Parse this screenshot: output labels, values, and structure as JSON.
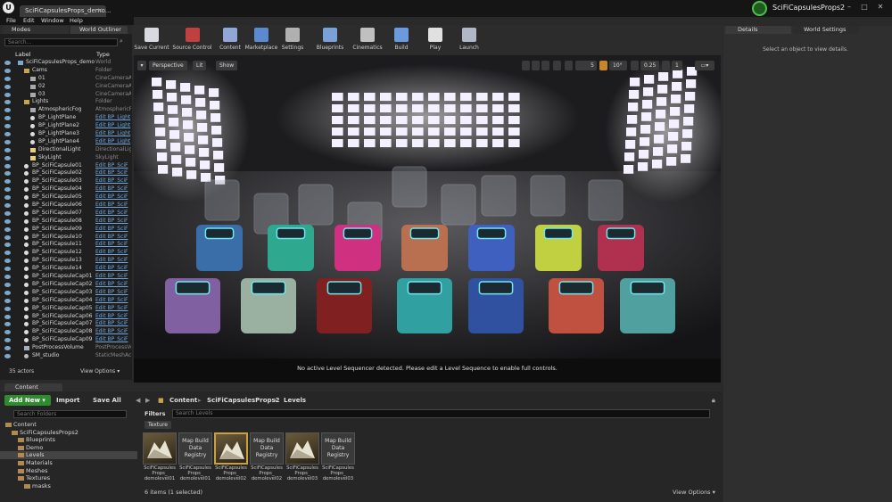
{
  "app": {
    "document_tab": "SciFiCapsulesProps_demo...",
    "project_name": "SciFiCapsulesProps2",
    "logo": "unreal-logo",
    "window_buttons": [
      "–",
      "□",
      "✕"
    ]
  },
  "menu": [
    "File",
    "Edit",
    "Window",
    "Help"
  ],
  "panels": {
    "modes_tab": "Modes",
    "outliner_tab": "World Outliner",
    "details_tab": "Details",
    "world_settings_tab": "World Settings",
    "content_browser_tab": "Content Browser"
  },
  "outliner": {
    "search_placeholder": "Search...",
    "col_label": "Label",
    "col_type": "Type",
    "rows": [
      {
        "label": "SciFiCapsulesProps_demo",
        "type": "World",
        "indent": 0,
        "icon": "world"
      },
      {
        "label": "Cams",
        "type": "Folder",
        "indent": 1,
        "icon": "folder"
      },
      {
        "label": "01",
        "type": "CineCameraA",
        "indent": 2,
        "icon": "camera"
      },
      {
        "label": "02",
        "type": "CineCameraA",
        "indent": 2,
        "icon": "camera"
      },
      {
        "label": "03",
        "type": "CineCameraA",
        "indent": 2,
        "icon": "camera"
      },
      {
        "label": "Lights",
        "type": "Folder",
        "indent": 1,
        "icon": "folder"
      },
      {
        "label": "AtmosphericFog",
        "type": "AtmosphericF",
        "indent": 2,
        "icon": "fog"
      },
      {
        "label": "BP_LightPlane",
        "type": "Edit BP_Light",
        "indent": 2,
        "icon": "bp",
        "link": true
      },
      {
        "label": "BP_LightPlane2",
        "type": "Edit BP_Light",
        "indent": 2,
        "icon": "bp",
        "link": true
      },
      {
        "label": "BP_LightPlane3",
        "type": "Edit BP_Light",
        "indent": 2,
        "icon": "bp",
        "link": true
      },
      {
        "label": "BP_LightPlane4",
        "type": "Edit BP_Light",
        "indent": 2,
        "icon": "bp",
        "link": true
      },
      {
        "label": "DirectionalLight",
        "type": "DirectionalLigh",
        "indent": 2,
        "icon": "light"
      },
      {
        "label": "SkyLight",
        "type": "SkyLight",
        "indent": 2,
        "icon": "light"
      },
      {
        "label": "BP_SciFiCapsule01",
        "type": "Edit BP_SciF",
        "indent": 1,
        "icon": "bp",
        "link": true
      },
      {
        "label": "BP_SciFiCapsule02",
        "type": "Edit BP_SciF",
        "indent": 1,
        "icon": "bp",
        "link": true
      },
      {
        "label": "BP_SciFiCapsule03",
        "type": "Edit BP_SciF",
        "indent": 1,
        "icon": "bp",
        "link": true
      },
      {
        "label": "BP_SciFiCapsule04",
        "type": "Edit BP_SciF",
        "indent": 1,
        "icon": "bp",
        "link": true
      },
      {
        "label": "BP_SciFiCapsule05",
        "type": "Edit BP_SciF",
        "indent": 1,
        "icon": "bp",
        "link": true
      },
      {
        "label": "BP_SciFiCapsule06",
        "type": "Edit BP_SciF",
        "indent": 1,
        "icon": "bp",
        "link": true
      },
      {
        "label": "BP_SciFiCapsule07",
        "type": "Edit BP_SciF",
        "indent": 1,
        "icon": "bp",
        "link": true
      },
      {
        "label": "BP_SciFiCapsule08",
        "type": "Edit BP_SciF",
        "indent": 1,
        "icon": "bp",
        "link": true
      },
      {
        "label": "BP_SciFiCapsule09",
        "type": "Edit BP_SciF",
        "indent": 1,
        "icon": "bp",
        "link": true
      },
      {
        "label": "BP_SciFiCapsule10",
        "type": "Edit BP_SciF",
        "indent": 1,
        "icon": "bp",
        "link": true
      },
      {
        "label": "BP_SciFiCapsule11",
        "type": "Edit BP_SciF",
        "indent": 1,
        "icon": "bp",
        "link": true
      },
      {
        "label": "BP_SciFiCapsule12",
        "type": "Edit BP_SciF",
        "indent": 1,
        "icon": "bp",
        "link": true
      },
      {
        "label": "BP_SciFiCapsule13",
        "type": "Edit BP_SciF",
        "indent": 1,
        "icon": "bp",
        "link": true
      },
      {
        "label": "BP_SciFiCapsule14",
        "type": "Edit BP_SciF",
        "indent": 1,
        "icon": "bp",
        "link": true
      },
      {
        "label": "BP_SciFiCapsuleCap01",
        "type": "Edit BP_SciF",
        "indent": 1,
        "icon": "bp",
        "link": true
      },
      {
        "label": "BP_SciFiCapsuleCap02",
        "type": "Edit BP_SciF",
        "indent": 1,
        "icon": "bp",
        "link": true
      },
      {
        "label": "BP_SciFiCapsuleCap03",
        "type": "Edit BP_SciF",
        "indent": 1,
        "icon": "bp",
        "link": true
      },
      {
        "label": "BP_SciFiCapsuleCap04",
        "type": "Edit BP_SciF",
        "indent": 1,
        "icon": "bp",
        "link": true
      },
      {
        "label": "BP_SciFiCapsuleCap05",
        "type": "Edit BP_SciF",
        "indent": 1,
        "icon": "bp",
        "link": true
      },
      {
        "label": "BP_SciFiCapsuleCap06",
        "type": "Edit BP_SciF",
        "indent": 1,
        "icon": "bp",
        "link": true
      },
      {
        "label": "BP_SciFiCapsuleCap07",
        "type": "Edit BP_SciF",
        "indent": 1,
        "icon": "bp",
        "link": true
      },
      {
        "label": "BP_SciFiCapsuleCap08",
        "type": "Edit BP_SciF",
        "indent": 1,
        "icon": "bp",
        "link": true
      },
      {
        "label": "BP_SciFiCapsuleCap09",
        "type": "Edit BP_SciF",
        "indent": 1,
        "icon": "bp",
        "link": true
      },
      {
        "label": "PostProcessVolume",
        "type": "PostProcessVo",
        "indent": 1,
        "icon": "volume"
      },
      {
        "label": "SM_studio",
        "type": "StaticMeshAc",
        "indent": 1,
        "icon": "mesh"
      }
    ],
    "actors_count": "35 actors",
    "view_options": "View Options ▾"
  },
  "toolbar": [
    {
      "label": "Save Current",
      "icon": "save-icon",
      "color": "#d8d8e0"
    },
    {
      "label": "Source Control",
      "icon": "source-control-icon",
      "color": "#c04040"
    },
    {
      "label": "Content",
      "icon": "content-icon",
      "color": "#8fa8d8"
    },
    {
      "label": "Marketplace",
      "icon": "marketplace-icon",
      "color": "#5a8ad0"
    },
    {
      "label": "Settings",
      "icon": "settings-icon",
      "color": "#b0b0b0"
    },
    {
      "label": "Blueprints",
      "icon": "blueprints-icon",
      "color": "#7aa0d8"
    },
    {
      "label": "Cinematics",
      "icon": "cinematics-icon",
      "color": "#c0c0c0"
    },
    {
      "label": "Build",
      "icon": "build-icon",
      "color": "#6a9ae0"
    },
    {
      "label": "Play",
      "icon": "play-icon",
      "color": "#e0e0e0"
    },
    {
      "label": "Launch",
      "icon": "launch-icon",
      "color": "#b0b8c8"
    }
  ],
  "viewport": {
    "perspective": "Perspective",
    "lit": "Lit",
    "show": "Show",
    "grid_snap": "5",
    "rotation_snap": "10°",
    "scale_snap": "0.25",
    "camera_speed": "1",
    "sequencer_message": "No active Level Sequencer detected. Please edit a Level Sequence to enable full controls."
  },
  "details": {
    "empty_message": "Select an object to view details."
  },
  "content_browser": {
    "add_new": "Add New ▾",
    "import": "Import",
    "save_all": "Save All",
    "breadcrumbs": [
      "Content",
      "SciFiCapsulesProps2",
      "Levels"
    ],
    "search_folders_placeholder": "Search Folders",
    "filters": "Filters ▾",
    "search_levels_placeholder": "Search Levels",
    "texture_filter": "Texture",
    "folders": [
      {
        "label": "Content",
        "indent": 0,
        "selected": false
      },
      {
        "label": "SciFiCapsulesProps2",
        "indent": 1,
        "selected": false
      },
      {
        "label": "Blueprints",
        "indent": 2,
        "selected": false
      },
      {
        "label": "Demo",
        "indent": 2,
        "selected": false
      },
      {
        "label": "Levels",
        "indent": 2,
        "selected": true
      },
      {
        "label": "Materials",
        "indent": 2,
        "selected": false
      },
      {
        "label": "Meshes",
        "indent": 2,
        "selected": false
      },
      {
        "label": "Textures",
        "indent": 2,
        "selected": false
      },
      {
        "label": "masks",
        "indent": 3,
        "selected": false
      }
    ],
    "assets": [
      {
        "kind": "level",
        "title": "",
        "name": "SciFiCapsules Props_ demolevel01"
      },
      {
        "kind": "registry",
        "title": "Map Build Data Registry",
        "name": "SciFiCapsules Props_ demolevel01"
      },
      {
        "kind": "level",
        "title": "",
        "name": "SciFiCapsules Props_ demolevel02",
        "selected": true
      },
      {
        "kind": "registry",
        "title": "Map Build Data Registry",
        "name": "SciFiCapsules Props_ demolevel02"
      },
      {
        "kind": "level",
        "title": "",
        "name": "SciFiCapsules Props_ demolevel03"
      },
      {
        "kind": "registry",
        "title": "Map Build Data Registry",
        "name": "SciFiCapsules Props_ demolevel03"
      }
    ],
    "items_count": "6 items (1 selected)",
    "view_options": "View Options ▾"
  }
}
